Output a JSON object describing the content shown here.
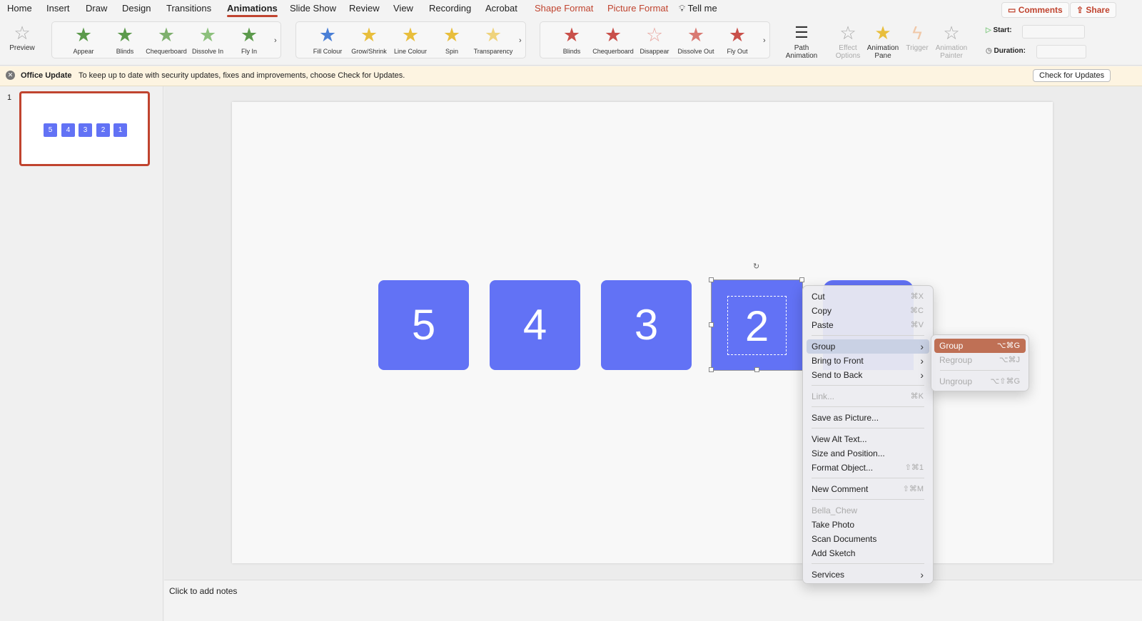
{
  "tabs": [
    "Home",
    "Insert",
    "Draw",
    "Design",
    "Transitions",
    "Animations",
    "Slide Show",
    "Review",
    "View",
    "Recording",
    "Acrobat",
    "Shape Format",
    "Picture Format"
  ],
  "tell_me": "Tell me",
  "comments": "Comments",
  "share": "Share",
  "preview": "Preview",
  "entrance": [
    "Appear",
    "Blinds",
    "Chequerboard",
    "Dissolve In",
    "Fly In"
  ],
  "emphasis": [
    "Fill Colour",
    "Grow/Shrink",
    "Line Colour",
    "Spin",
    "Transparency"
  ],
  "exit": [
    "Blinds",
    "Chequerboard",
    "Disappear",
    "Dissolve Out",
    "Fly Out"
  ],
  "path_animation": [
    "Path",
    "Animation"
  ],
  "effect_options": [
    "Effect",
    "Options"
  ],
  "animation_pane": [
    "Animation",
    "Pane"
  ],
  "trigger": "Trigger",
  "animation_painter": [
    "Animation",
    "Painter"
  ],
  "start_label": "Start:",
  "duration_label": "Duration:",
  "banner": {
    "title": "Office Update",
    "message": "To keep up to date with security updates, fixes and improvements, choose Check for Updates.",
    "button": "Check for Updates"
  },
  "slide_number": "1",
  "squares": [
    "5",
    "4",
    "3",
    "2"
  ],
  "thumb_squares": [
    "5",
    "4",
    "3",
    "2",
    "1"
  ],
  "notes_placeholder": "Click to add notes",
  "context_menu": [
    {
      "label": "Cut",
      "shortcut": "⌘X"
    },
    {
      "label": "Copy",
      "shortcut": "⌘C"
    },
    {
      "label": "Paste",
      "shortcut": "⌘V"
    },
    {
      "label": "Group",
      "shortcut": "›"
    },
    {
      "label": "Bring to Front",
      "shortcut": "›"
    },
    {
      "label": "Send to Back",
      "shortcut": "›"
    },
    {
      "label": "Link...",
      "shortcut": "⌘K"
    },
    {
      "label": "Save as Picture..."
    },
    {
      "label": "View Alt Text..."
    },
    {
      "label": "Size and Position..."
    },
    {
      "label": "Format Object...",
      "shortcut": "⇧⌘1"
    },
    {
      "label": "New Comment",
      "shortcut": "⇧⌘M"
    },
    {
      "label": "Bella_Chew"
    },
    {
      "label": "Take Photo"
    },
    {
      "label": "Scan Documents"
    },
    {
      "label": "Add Sketch"
    },
    {
      "label": "Services",
      "shortcut": "›"
    }
  ],
  "submenu": [
    {
      "label": "Group",
      "shortcut": "⌥⌘G"
    },
    {
      "label": "Regroup",
      "shortcut": "⌥⌘J"
    },
    {
      "label": "Ungroup",
      "shortcut": "⌥⇧⌘G"
    }
  ],
  "colors": {
    "accent": "#c0442f",
    "shape": "#6272f5",
    "entrance": "#5c9a4c",
    "emphasis": "#e8be3c",
    "exit": "#c9504a"
  }
}
